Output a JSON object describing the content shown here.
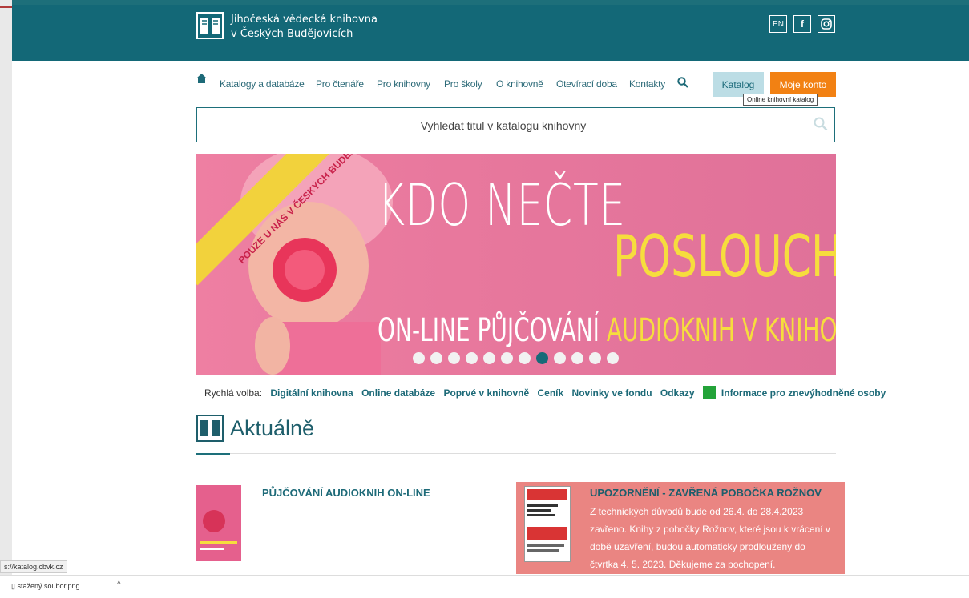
{
  "header": {
    "title_line1": "Jihočeská vědecká knihovna",
    "title_line2": "v Českých Budějovicích",
    "lang_label": "EN",
    "facebook_label": "f"
  },
  "nav": {
    "items": [
      "Katalogy a databáze",
      "Pro čtenáře",
      "Pro knihovny",
      "Pro školy",
      "O knihovně",
      "Otevírací doba",
      "Kontakty"
    ],
    "katalog_label": "Katalog",
    "konto_label": "Moje konto",
    "tooltip": "Online knihovní katalog"
  },
  "search": {
    "placeholder": "Vyhledat titul v katalogu knihovny"
  },
  "banner": {
    "title": "KDO NEČTE",
    "subtitle": "POSLOUCHÁ",
    "bottom_white": "ON-LINE PŮJČOVÁNÍ",
    "bottom_yellow": "AUDIOKNIH V KNIHOVNĚ",
    "ribbon": "POUZE U NÁS V ČESKÝCH BUDĚJOVICÍCH",
    "dot_count": 12,
    "active_dot": 7
  },
  "quick": {
    "label": "Rychlá volba:",
    "links": [
      "Digitální knihovna",
      "Online databáze",
      "Poprvé v knihovně",
      "Ceník",
      "Novinky ve fondu",
      "Odkazy"
    ],
    "access_link": "Informace pro znevýhodněné osoby"
  },
  "news": {
    "heading": "Aktuálně",
    "article1_title": "PŮJČOVÁNÍ AUDIOKNIH ON-LINE",
    "article2_title": "UPOZORNĚNÍ - ZAVŘENÁ POBOČKA ROŽNOV",
    "article2_text": "Z technických důvodů bude od 26.4. do 28.4.2023 zavřeno. Knihy z pobočky Rožnov, které jsou k vrácení v době uzavření, budou automaticky prodlouženy do čtvrtka 4. 5. 2023. Děkujeme za pochopení."
  },
  "browser": {
    "status_url": "s://katalog.cbvk.cz",
    "download_file": "stažený soubor.png"
  },
  "colors": {
    "header": "#136877",
    "accent_orange": "#f28113",
    "banner_pink": "#ee7fa2",
    "banner_yellow": "#f6dd3d"
  }
}
